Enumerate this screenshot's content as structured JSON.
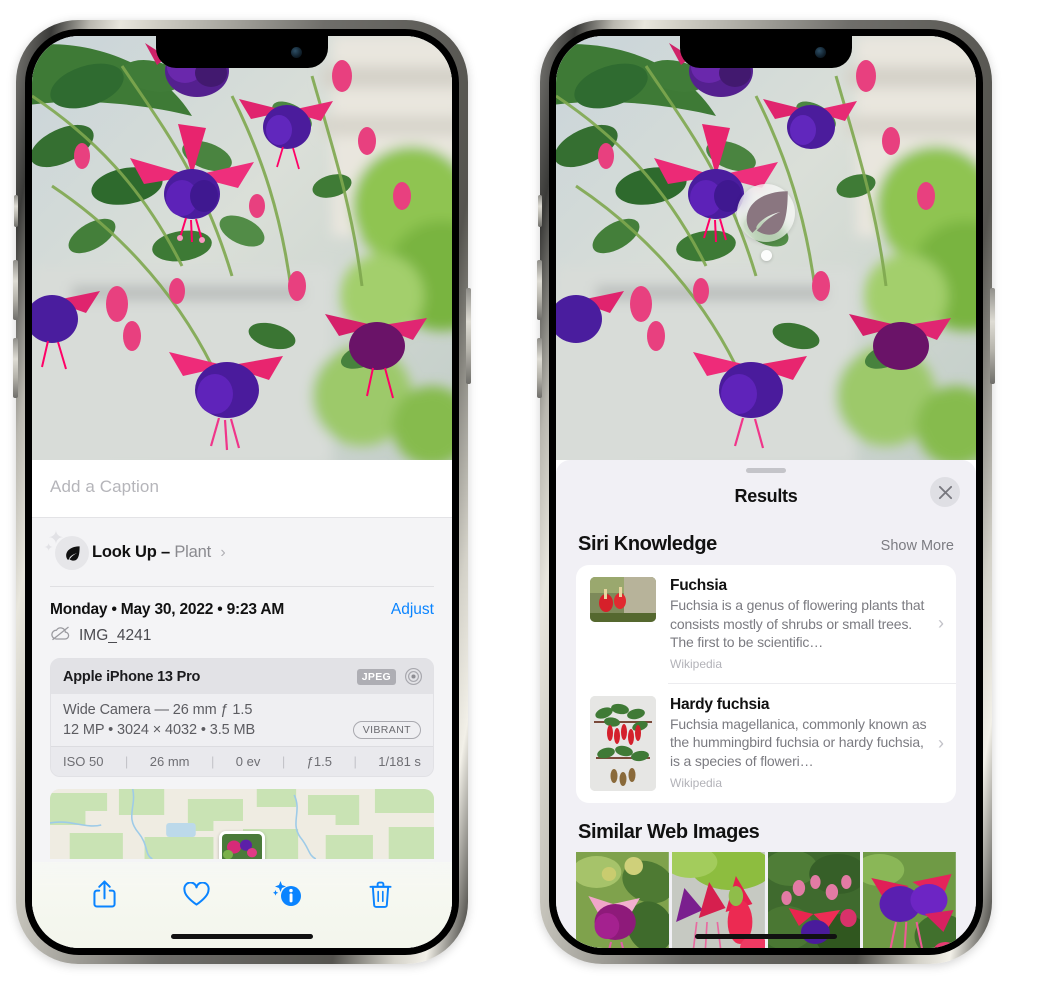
{
  "meta": {
    "accent_blue": "#0a84ff",
    "sheet_bg": "#f1f0f5",
    "badge_grey": "#aeaeb4"
  },
  "left_phone": {
    "name": "photos-detail-screen",
    "caption": {
      "placeholder": "Add a Caption",
      "value": ""
    },
    "lookup": {
      "icon": "leaf-icon",
      "label": "Look Up",
      "dash": "–",
      "subject": "Plant",
      "chevron": "›"
    },
    "info": {
      "date_line": "Monday • May 30, 2022 • 9:23 AM",
      "adjust_label": "Adjust",
      "cloud_icon": "icloud-slash-icon",
      "filename": "IMG_4241"
    },
    "camera_card": {
      "model": "Apple iPhone 13 Pro",
      "format_badge": "JPEG",
      "aperture_icon": "aperture-icon",
      "lens_line": "Wide Camera — 26 mm ƒ 1.5",
      "size_line": "12 MP • 3024 × 4032 • 3.5 MB",
      "style_badge": "VIBRANT",
      "exif": [
        "ISO 50",
        "26 mm",
        "0 ev",
        "ƒ1.5",
        "1/181 s"
      ]
    },
    "map": {
      "label": "photo-location-map"
    },
    "toolbar": [
      {
        "name": "share-icon",
        "label": "Share"
      },
      {
        "name": "heart-icon",
        "label": "Favorite"
      },
      {
        "name": "info-icon",
        "label": "Info"
      },
      {
        "name": "trash-icon",
        "label": "Delete"
      }
    ]
  },
  "right_phone": {
    "name": "visual-look-up-results-screen",
    "photo_badge": {
      "icon": "leaf-icon",
      "label": "Visual Look Up plant badge"
    },
    "sheet": {
      "grabber": "drag-handle",
      "title": "Results",
      "close_icon": "✕"
    },
    "siri_knowledge": {
      "title": "Siri Knowledge",
      "action": "Show More",
      "items": [
        {
          "title": "Fuchsia",
          "description": "Fuchsia is a genus of flowering plants that consists mostly of shrubs or small trees. The first to be scientific…",
          "source": "Wikipedia",
          "chevron": "›",
          "thumb": "fuchsia-red-flowers-thumbnail"
        },
        {
          "title": "Hardy fuchsia",
          "description": "Fuchsia magellanica, commonly known as the hummingbird fuchsia or hardy fuchsia, is a species of floweri…",
          "source": "Wikipedia",
          "chevron": "›",
          "thumb": "hardy-fuchsia-branch-thumbnail"
        }
      ]
    },
    "similar_web_images": {
      "title": "Similar Web Images",
      "items": [
        "fuchsia-pink-white-bloom",
        "fuchsia-red-magenta-closeup",
        "fuchsia-bush-many-buds",
        "fuchsia-purple-red-cluster"
      ]
    }
  }
}
